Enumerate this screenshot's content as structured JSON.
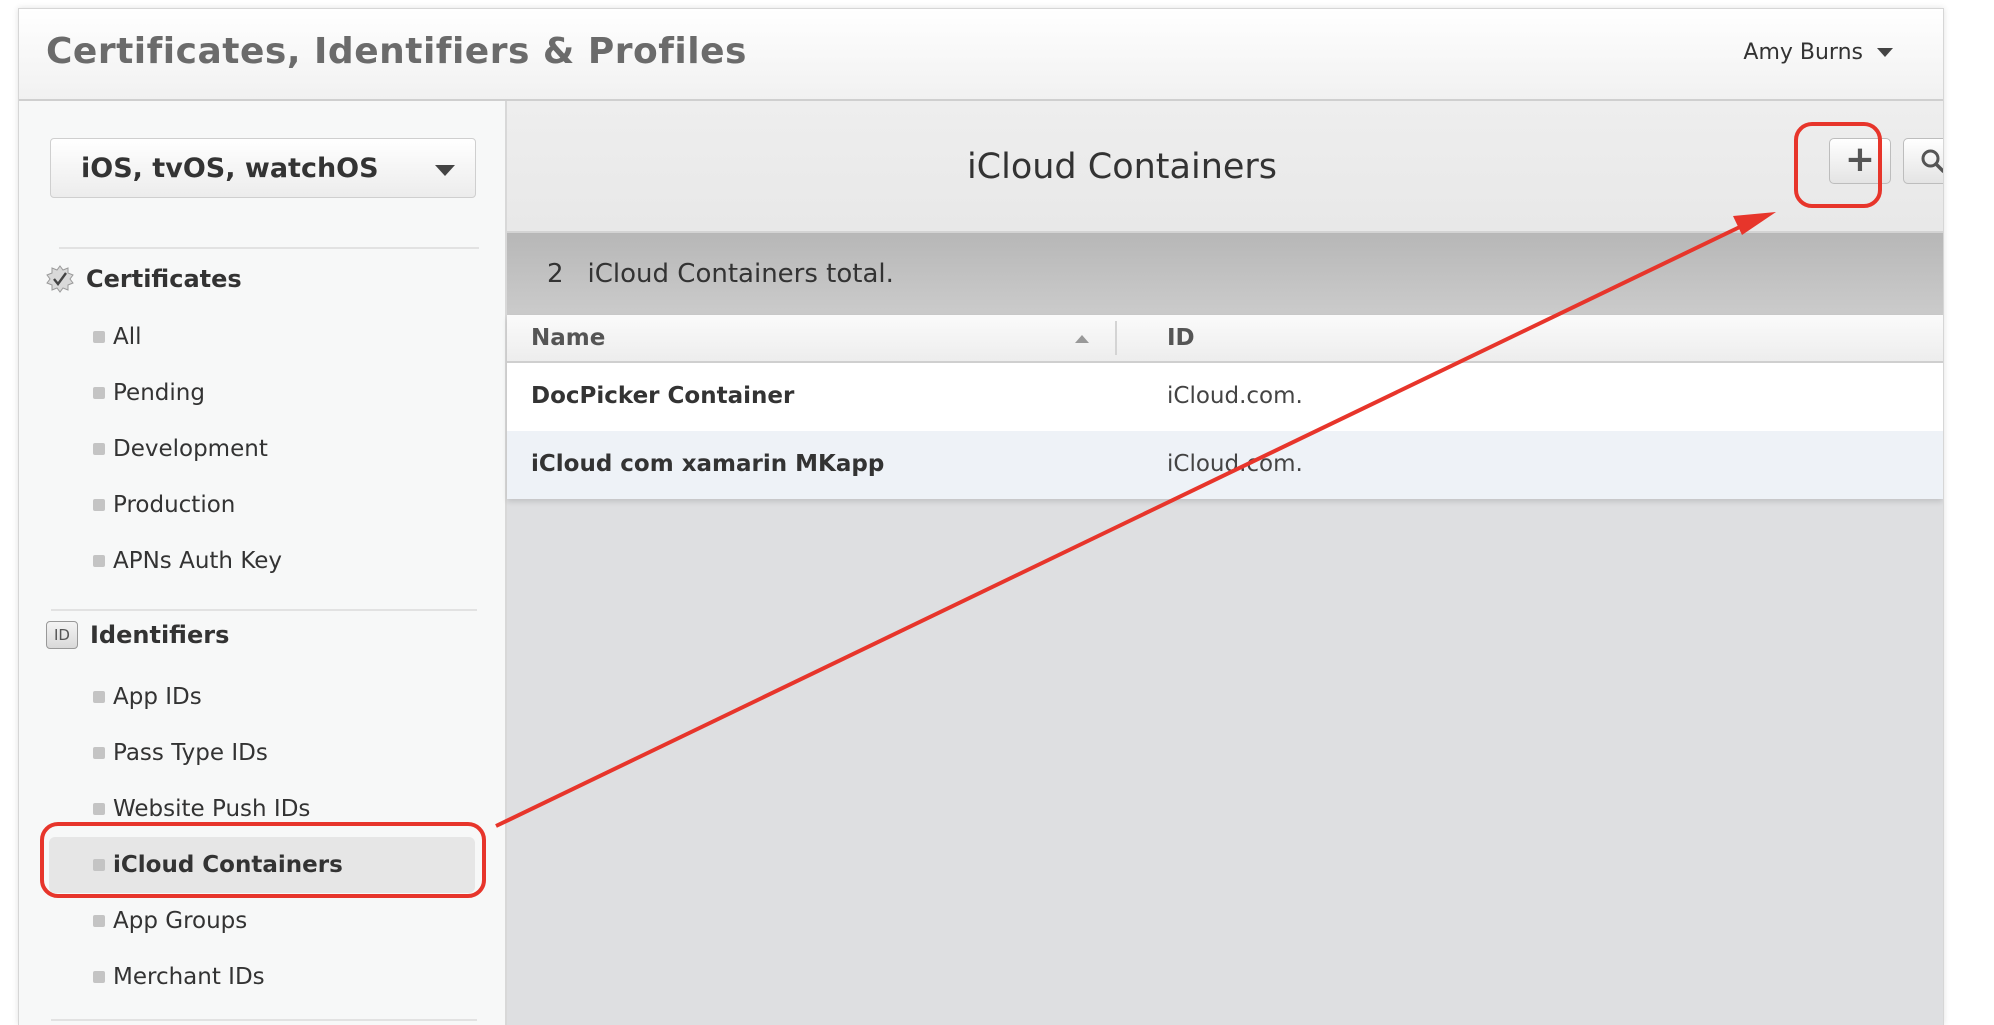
{
  "header": {
    "title": "Certificates, Identifiers & Profiles",
    "user_name": "Amy Burns"
  },
  "sidebar": {
    "platform": "iOS, tvOS, watchOS",
    "sections": [
      {
        "title": "Certificates",
        "icon": "certificate-badge-icon",
        "items": [
          "All",
          "Pending",
          "Development",
          "Production",
          "APNs Auth Key"
        ]
      },
      {
        "title": "Identifiers",
        "icon_text": "ID",
        "items": [
          "App IDs",
          "Pass Type IDs",
          "Website Push IDs",
          "iCloud Containers",
          "App Groups",
          "Merchant IDs"
        ]
      }
    ],
    "active_item": "iCloud Containers"
  },
  "main": {
    "title": "iCloud Containers",
    "total_count": "2",
    "total_label": "iCloud Containers total.",
    "columns": [
      "Name",
      "ID"
    ],
    "rows": [
      {
        "name": "DocPicker Container",
        "id": "iCloud.com."
      },
      {
        "name": "iCloud com xamarin MKapp",
        "id": "iCloud.com."
      }
    ],
    "add_label": "+"
  },
  "annotation": {
    "color": "#e7352b"
  }
}
